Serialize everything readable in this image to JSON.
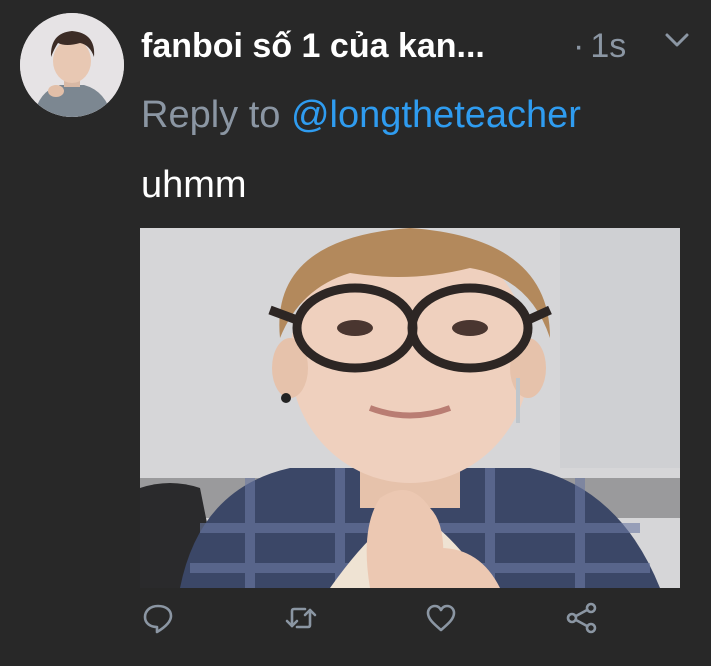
{
  "tweet": {
    "display_name": "fanboi số 1 của kan...",
    "time_separator": "·",
    "time": "1s",
    "reply_prefix": "Reply to",
    "reply_handle": "@longtheteacher",
    "text": "uhmm"
  },
  "icons": {
    "more": "chevron-down-icon",
    "reply": "reply-icon",
    "retweet": "retweet-icon",
    "like": "heart-icon",
    "share": "share-icon"
  },
  "colors": {
    "background": "#282828",
    "muted": "#8b96a3",
    "link": "#2f9cf0",
    "text": "#ffffff"
  }
}
